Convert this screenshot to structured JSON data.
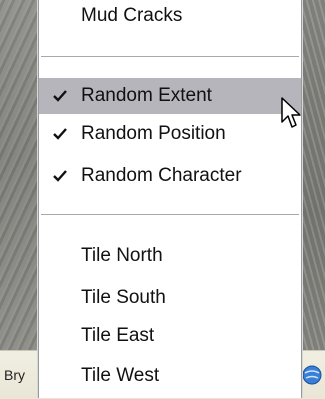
{
  "menu": {
    "top_item": {
      "label": "Mud Cracks"
    },
    "random_items": [
      {
        "label": "Random Extent",
        "checked": true,
        "highlighted": true
      },
      {
        "label": "Random Position",
        "checked": true,
        "highlighted": false
      },
      {
        "label": "Random Character",
        "checked": true,
        "highlighted": false
      }
    ],
    "tile_items": [
      {
        "label": "Tile North"
      },
      {
        "label": "Tile South"
      },
      {
        "label": "Tile East"
      },
      {
        "label": "Tile West"
      }
    ],
    "highlight_color": "#b5b5bb"
  },
  "statusbar": {
    "left_text": "Bry",
    "right_icon": "globe-icon"
  },
  "cursor": {
    "icon": "arrow-cursor-icon"
  }
}
